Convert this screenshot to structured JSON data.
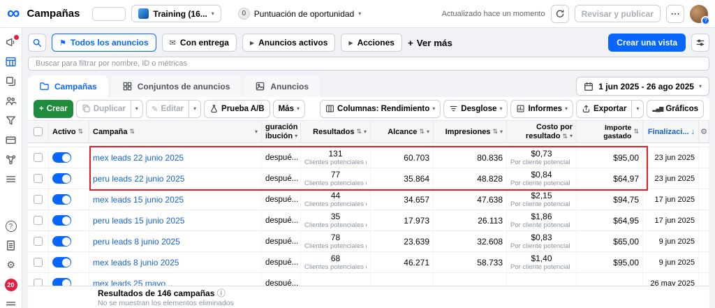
{
  "colors": {
    "accent": "#0866ff",
    "create_green": "#1e8c3c",
    "link_blue": "#1763cf",
    "annotation_red": "#e81c24"
  },
  "icons": {
    "meta-logo": "∞",
    "all-ads-icon": "⚑",
    "delivery-icon": "✉",
    "active-ads-icon": "▶",
    "actions-icon": "▶",
    "plus-icon": "+",
    "edit-icon": "✎",
    "charts-icon": "▂▄▆",
    "more-icon": "⋯",
    "gear-icon": "⚙",
    "info-icon": "ⓘ",
    "sort-icon": "⇅",
    "caret-down-icon": "▾",
    "sorted-desc-icon": "↓",
    "help-icon": "?",
    "badge-count": "20"
  },
  "topbar": {
    "title": "Campañas",
    "account": "Training (16...",
    "opportunity_score": "0",
    "opportunity_label": "Puntuación de oportunidad",
    "updated": "Actualizado hace un momento",
    "review_publish": "Revisar y publicar"
  },
  "filter_bar": {
    "chips": [
      {
        "label": "Todos los anuncios"
      },
      {
        "label": "Con entrega"
      },
      {
        "label": "Anuncios activos"
      },
      {
        "label": "Acciones"
      }
    ],
    "see_more": "Ver más",
    "create_view": "Crear una vista"
  },
  "search": {
    "placeholder": "Buscar para filtrar por nombre, ID o métricas"
  },
  "tabs": [
    {
      "label": "Campañas"
    },
    {
      "label": "Conjuntos de anuncios"
    },
    {
      "label": "Anuncios"
    }
  ],
  "date_range": "1 jun 2025 - 26 ago 2025",
  "toolbar": {
    "create": "Crear",
    "duplicate": "Duplicar",
    "edit": "Editar",
    "ab_test": "Prueba A/B",
    "more": "Más",
    "columns": "Columnas: Rendimiento",
    "breakdown": "Desglose",
    "reports": "Informes",
    "export": "Exportar",
    "charts": "Gráficos"
  },
  "table": {
    "headers": {
      "active": "Activo",
      "campaign": "Campaña",
      "attribution_line1": "guración",
      "attribution_line2": "ibución",
      "results": "Resultados",
      "reach": "Alcance",
      "impressions": "Impresiones",
      "cost_line1": "Costo por",
      "cost_line2": "resultado",
      "spent": "Importe gastado",
      "end": "Finalizaci..."
    },
    "rows": [
      {
        "name": "mex leads 22 junio 2025",
        "attribution": "despué...",
        "results": "131",
        "results_sub": "Clientes potenciales d...",
        "reach": "60.703",
        "impressions": "80.836",
        "cost": "$0,73",
        "cost_sub": "Por cliente potencial ...",
        "spent": "$95,00",
        "end": "23 jun 2025"
      },
      {
        "name": "peru leads 22 junio 2025",
        "attribution": "despué...",
        "results": "77",
        "results_sub": "Clientes potenciales d...",
        "reach": "35.864",
        "impressions": "48.828",
        "cost": "$0,84",
        "cost_sub": "Por cliente potencial ...",
        "spent": "$64,97",
        "end": "23 jun 2025"
      },
      {
        "name": "mex leads 15 junio 2025",
        "attribution": "despué...",
        "results": "44",
        "results_sub": "Clientes potenciales d...",
        "reach": "34.657",
        "impressions": "47.638",
        "cost": "$2,15",
        "cost_sub": "Por cliente potencial ...",
        "spent": "$94,75",
        "end": "17 jun 2025"
      },
      {
        "name": "peru leads 15 junio 2025",
        "attribution": "despué...",
        "results": "35",
        "results_sub": "Clientes potenciales d...",
        "reach": "17.973",
        "impressions": "26.113",
        "cost": "$1,86",
        "cost_sub": "Por cliente potencial ...",
        "spent": "$64,95",
        "end": "17 jun 2025"
      },
      {
        "name": "peru leads 8 junio 2025",
        "attribution": "despué...",
        "results": "78",
        "results_sub": "Clientes potenciales d...",
        "reach": "23.639",
        "impressions": "32.608",
        "cost": "$0,83",
        "cost_sub": "Por cliente potencial ...",
        "spent": "$65,00",
        "end": "9 jun 2025"
      },
      {
        "name": "mex leads 8 junio 2025",
        "attribution": "despué...",
        "results": "68",
        "results_sub": "Clientes potenciales d...",
        "reach": "46.271",
        "impressions": "58.733",
        "cost": "$1,40",
        "cost_sub": "Por cliente potencial ...",
        "spent": "$95,00",
        "end": "9 jun 2025"
      },
      {
        "name": "mex leads 25 mayo...",
        "attribution": "despué...",
        "end": "26 may 2025"
      }
    ]
  },
  "footer": {
    "results": "Resultados de 146 campañas",
    "note": "No se muestran los elementos eliminados"
  }
}
